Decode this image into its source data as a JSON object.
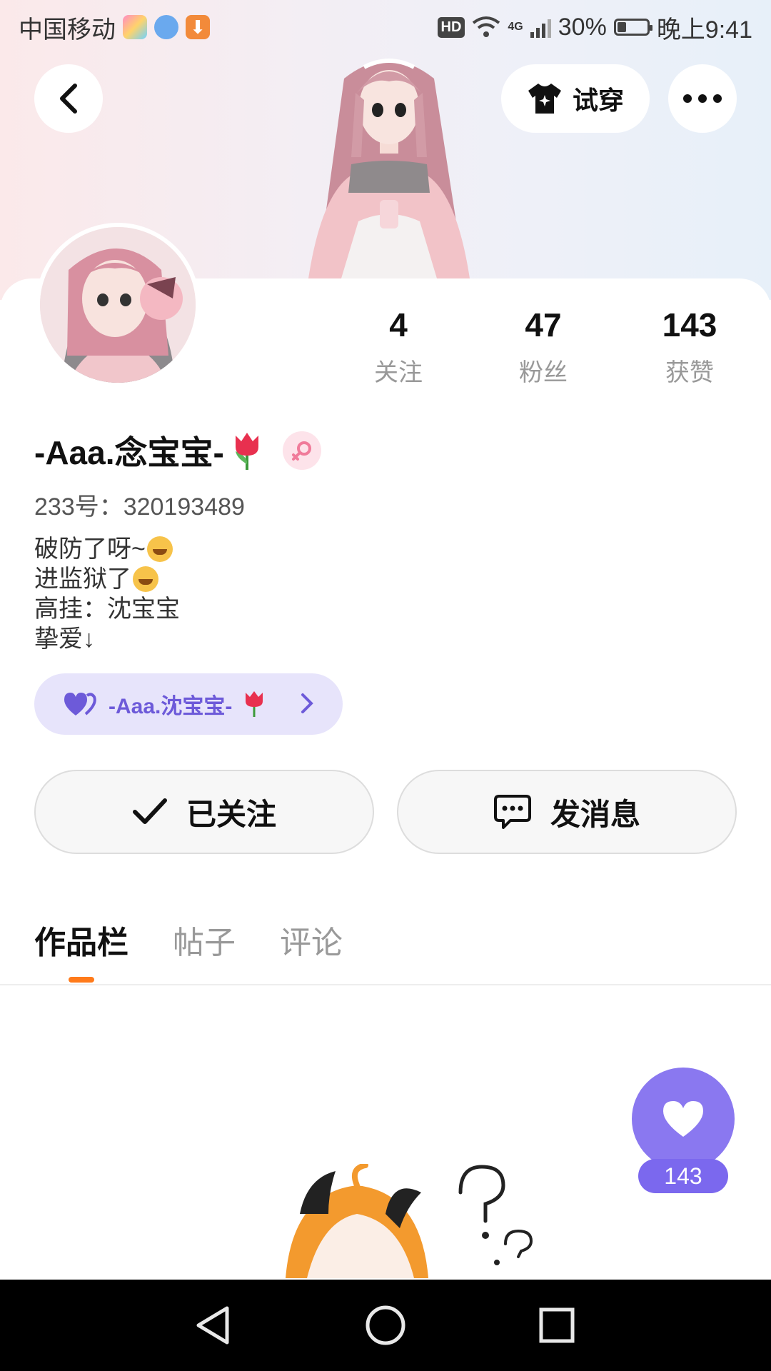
{
  "status_bar": {
    "carrier": "中国移动",
    "network": "4G",
    "battery": "30%",
    "time": "晚上9:41",
    "hd_badge": "HD"
  },
  "header": {
    "back_icon": "chevron-left-icon",
    "tryon_label": "试穿",
    "more_icon": "more-dots-icon"
  },
  "stats": [
    {
      "value": "4",
      "label": "关注"
    },
    {
      "value": "47",
      "label": "粉丝"
    },
    {
      "value": "143",
      "label": "获赞"
    }
  ],
  "profile": {
    "username": "-Aaa.念宝宝-",
    "uid_label": "233号：",
    "uid": "320193489",
    "bio_lines": [
      "破防了呀~",
      "进监狱了",
      "高挂：沈宝宝",
      "挚爱↓"
    ],
    "cp_name": "-Aaa.沈宝宝-"
  },
  "actions": {
    "follow_label": "已关注",
    "message_label": "发消息"
  },
  "tabs": [
    {
      "label": "作品栏",
      "active": true
    },
    {
      "label": "帖子",
      "active": false
    },
    {
      "label": "评论",
      "active": false
    }
  ],
  "like_fab": {
    "count": "143"
  },
  "colors": {
    "accent": "#7b68ee",
    "tab_indicator": "#ff7a1a",
    "pill_bg": "#e7e4fb",
    "pill_text": "#6d5ad9"
  }
}
